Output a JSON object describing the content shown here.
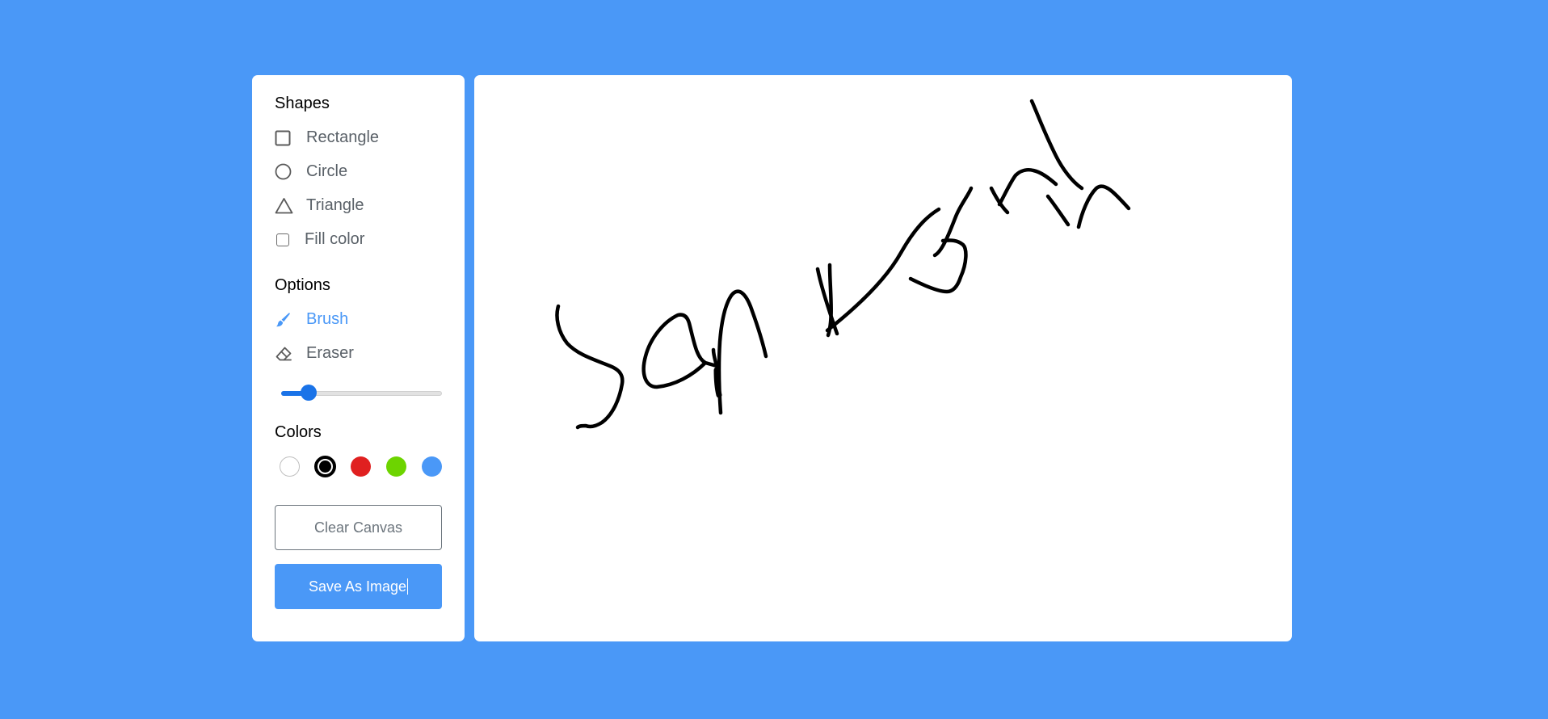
{
  "shapes": {
    "title": "Shapes",
    "items": [
      {
        "label": "Rectangle",
        "icon": "rectangle-icon"
      },
      {
        "label": "Circle",
        "icon": "circle-icon"
      },
      {
        "label": "Triangle",
        "icon": "triangle-icon"
      }
    ],
    "fill_label": "Fill color",
    "fill_checked": false
  },
  "options": {
    "title": "Options",
    "brush_label": "Brush",
    "eraser_label": "Eraser",
    "active": "brush",
    "brush_size_fraction": 0.17
  },
  "colors": {
    "title": "Colors",
    "swatches": [
      "#ffffff",
      "#000000",
      "#e02020",
      "#6dd400",
      "#4a98f7"
    ],
    "selected": "#000000"
  },
  "buttons": {
    "clear_label": "Clear Canvas",
    "save_label": "Save As Image"
  },
  "theme": {
    "background": "#4a98f7",
    "accent": "#4a98f7",
    "slider": "#1a73e8"
  }
}
